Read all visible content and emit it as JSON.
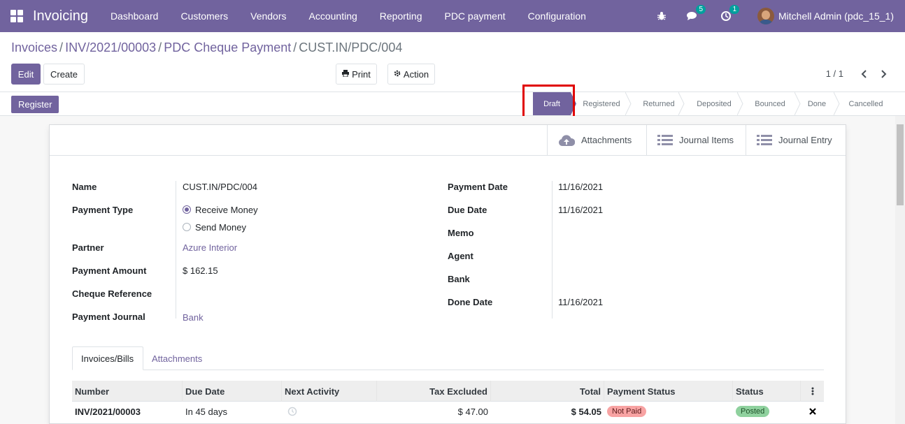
{
  "navbar": {
    "brand": "Invoicing",
    "menu": [
      "Dashboard",
      "Customers",
      "Vendors",
      "Accounting",
      "Reporting",
      "PDC payment",
      "Configuration"
    ],
    "messages_count": "5",
    "activities_count": "1",
    "user": "Mitchell Admin (pdc_15_1)"
  },
  "breadcrumb": {
    "items": [
      "Invoices",
      "INV/2021/00003",
      "PDC Cheque Payment"
    ],
    "current": "CUST.IN/PDC/004",
    "separator": "/"
  },
  "toolbar": {
    "edit": "Edit",
    "create": "Create",
    "print": "Print",
    "action": "Action",
    "pager": "1 / 1"
  },
  "statusbar": {
    "register": "Register",
    "stages": [
      "Draft",
      "Registered",
      "Returned",
      "Deposited",
      "Bounced",
      "Done",
      "Cancelled"
    ],
    "active_stage": "Draft"
  },
  "smart_buttons": {
    "attachments": "Attachments",
    "journal_items": "Journal Items",
    "journal_entry": "Journal Entry"
  },
  "form": {
    "left": {
      "name_label": "Name",
      "name_value": "CUST.IN/PDC/004",
      "payment_type_label": "Payment Type",
      "payment_type_options": [
        "Receive Money",
        "Send Money"
      ],
      "payment_type_selected": "Receive Money",
      "partner_label": "Partner",
      "partner_value": "Azure Interior",
      "amount_label": "Payment Amount",
      "amount_value": "$ 162.15",
      "cheque_label": "Cheque Reference",
      "cheque_value": "",
      "journal_label": "Payment Journal",
      "journal_value": "Bank"
    },
    "right": {
      "payment_date_label": "Payment Date",
      "payment_date_value": "11/16/2021",
      "due_date_label": "Due Date",
      "due_date_value": "11/16/2021",
      "memo_label": "Memo",
      "memo_value": "",
      "agent_label": "Agent",
      "agent_value": "",
      "bank_label": "Bank",
      "bank_value": "",
      "done_date_label": "Done Date",
      "done_date_value": "11/16/2021"
    }
  },
  "tabs": [
    "Invoices/Bills",
    "Attachments"
  ],
  "table": {
    "headers": [
      "Number",
      "Due Date",
      "Next Activity",
      "Tax Excluded",
      "Total",
      "Payment Status",
      "Status"
    ],
    "rows": [
      {
        "number": "INV/2021/00003",
        "due_date": "In 45 days",
        "tax_excluded": "$ 47.00",
        "total": "$ 54.05",
        "payment_status": "Not Paid",
        "status": "Posted"
      }
    ]
  },
  "colors": {
    "primary": "#71639e",
    "highlight": "#e00000",
    "not_paid_badge": "#f8a3a3",
    "posted_badge": "#8fd19e"
  }
}
